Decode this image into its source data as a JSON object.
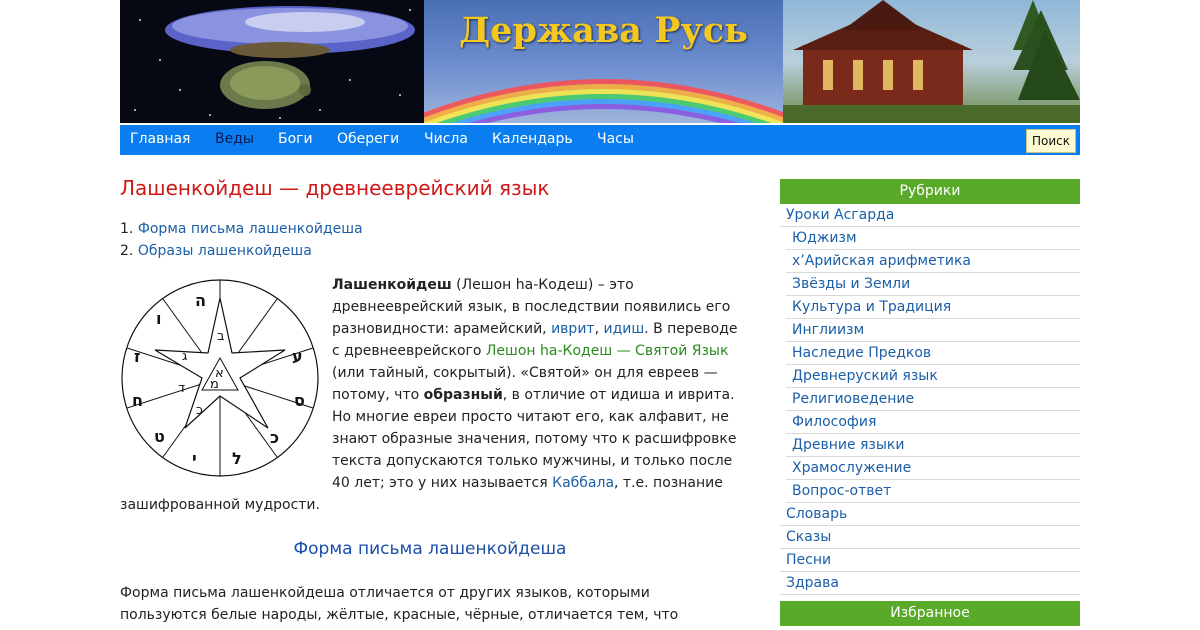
{
  "header": {
    "site_title": "Держава Русь"
  },
  "nav": {
    "items": [
      "Главная",
      "Веды",
      "Боги",
      "Обереги",
      "Числа",
      "Календарь",
      "Часы"
    ],
    "search_label": "Поиск"
  },
  "article": {
    "title": "Лашенкойдеш — древнееврейский язык",
    "toc": [
      "1. ",
      "Форма письма лашенкойдеша",
      "2. ",
      "Образы лашенкойдеша"
    ],
    "para1": {
      "bold1": "Лашенкойдеш",
      "t1": " (Лешон hа-Кодеш) – это древнееврейский язык, в последствии появились его разновидности: арамейский, ",
      "link1": "иврит",
      "t2": ", ",
      "link2": "идиш",
      "t3": ". В переводе с древнееврейского ",
      "link3": "Лешон hа-Кодеш — Святой Язык",
      "t4": " (или тайный, сокрытый). «Святой» он для евреев — потому, что ",
      "bold2": "образный",
      "t5": ", в отличие от идиша и иврита. Но многие евреи просто читают его, как алфавит, не знают образные значения, потому что к расшифровке текста допускаются только мужчины, и только после 40 лет; это у них называется ",
      "link4": "Каббала",
      "t6": ", т.е. познание зашифрованной мудрости."
    },
    "section_heading": "Форма письма лашенкойдеша",
    "para2": "Форма письма лашенкойдеша отличается от других языков, которыми пользуются белые народы, жёлтые, красные, чёрные, отличается тем, что",
    "diagram_letters": [
      "ה",
      "ו",
      "ז",
      "ח",
      "ט",
      "י",
      "ל",
      "כ",
      "ס",
      "ע",
      "ב",
      "ג",
      "ד",
      "כ",
      "א",
      "מ"
    ]
  },
  "sidebar": {
    "heading": "Рубрики",
    "items": [
      {
        "label": "Уроки Асгарда",
        "sub": false
      },
      {
        "label": "Юджизм",
        "sub": true
      },
      {
        "label": "х’Арийская арифметика",
        "sub": true
      },
      {
        "label": "Звёзды и Земли",
        "sub": true
      },
      {
        "label": "Культура и Традиция",
        "sub": true
      },
      {
        "label": "Инглиизм",
        "sub": true
      },
      {
        "label": "Наследие Предков",
        "sub": true
      },
      {
        "label": "Древнеруский язык",
        "sub": true
      },
      {
        "label": "Религиоведение",
        "sub": true
      },
      {
        "label": "Философия",
        "sub": true
      },
      {
        "label": "Древние языки",
        "sub": true
      },
      {
        "label": "Храмослужение",
        "sub": true
      },
      {
        "label": "Вопрос-ответ",
        "sub": true
      },
      {
        "label": "Словарь",
        "sub": false
      },
      {
        "label": "Сказы",
        "sub": false
      },
      {
        "label": "Песни",
        "sub": false
      },
      {
        "label": "Здрава",
        "sub": false
      }
    ],
    "heading2": "Избранное"
  }
}
